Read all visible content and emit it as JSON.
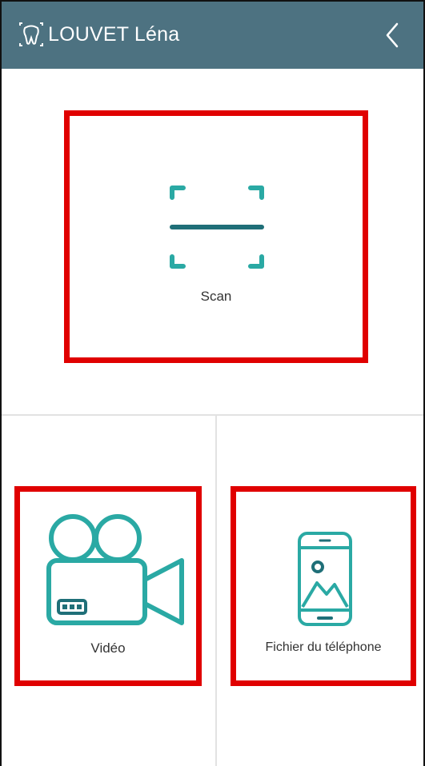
{
  "header": {
    "title": "LOUVET Léna",
    "tooth_icon": "tooth-icon",
    "back_icon": "chevron-left-icon",
    "background_color": "#4d7281"
  },
  "tiles": {
    "scan": {
      "label": "Scan",
      "icon": "scan-icon"
    },
    "video": {
      "label": "Vidéo",
      "icon": "video-camera-icon"
    },
    "file": {
      "label": "Fichier du téléphone",
      "icon": "phone-gallery-icon"
    }
  },
  "colors": {
    "accent_teal": "#2aa9a4",
    "dark_teal": "#1f6f78",
    "highlight_red": "#e00000"
  }
}
